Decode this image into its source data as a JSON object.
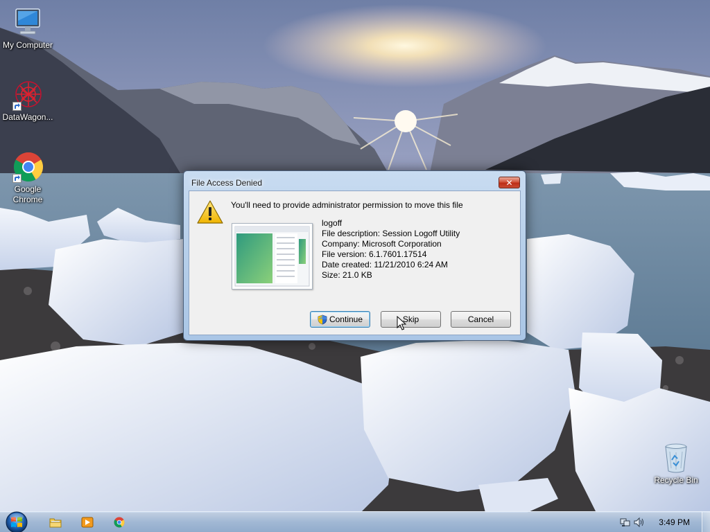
{
  "desktop": {
    "icons": [
      {
        "label": "My Computer",
        "icon": "computer-icon"
      },
      {
        "label": "DataWagon...",
        "icon": "datawagon-icon"
      },
      {
        "label": "Google Chrome",
        "icon": "chrome-icon"
      },
      {
        "label": "Recycle Bin",
        "icon": "recycle-bin-icon"
      }
    ]
  },
  "dialog": {
    "title": "File Access Denied",
    "close_label": "✕",
    "message": "You'll need to provide administrator permission to move this file",
    "file": {
      "name": "logoff",
      "description": "File description: Session Logoff Utility",
      "company": "Company: Microsoft Corporation",
      "version": "File version: 6.1.7601.17514",
      "date_created": "Date created: 11/21/2010 6:24 AM",
      "size": "Size: 21.0 KB"
    },
    "buttons": {
      "continue": "Continue",
      "skip": "Skip",
      "cancel": "Cancel"
    }
  },
  "taskbar": {
    "pinned": [
      "file-explorer-icon",
      "media-player-icon",
      "chrome-icon"
    ],
    "tray_icons": [
      "network-icon",
      "volume-icon"
    ],
    "clock": "3:49 PM"
  },
  "colors": {
    "taskbar": "#a9c3e1",
    "dialog_frame": "#b8d0ea",
    "close_button": "#c84a33",
    "dialog_body": "#f0f0f0"
  }
}
